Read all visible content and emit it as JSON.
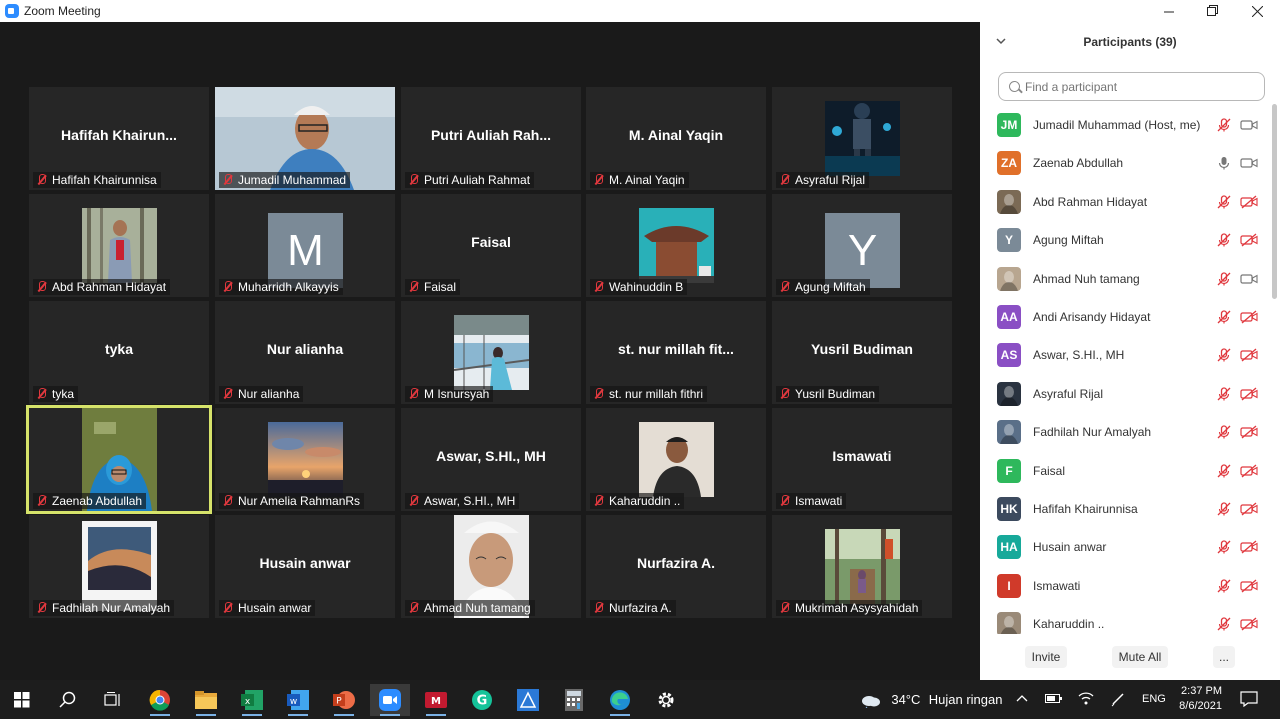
{
  "window": {
    "title": "Zoom Meeting"
  },
  "tiles": [
    {
      "label": "Hafifah Khairunnisa",
      "bigname": "Hafifah  Khairun...",
      "kind": "name"
    },
    {
      "label": "Jumadil Muhammad",
      "kind": "video-jumadil"
    },
    {
      "label": "Putri Auliah Rahmat",
      "bigname": "Putri  Auliah  Rah...",
      "kind": "name"
    },
    {
      "label": "M. Ainal Yaqin",
      "bigname": "M. Ainal Yaqin",
      "kind": "name"
    },
    {
      "label": "Asyraful Rijal",
      "kind": "photo-game"
    },
    {
      "label": "Abd Rahman Hidayat",
      "kind": "photo-park"
    },
    {
      "label": "Muharridh Alkayyis",
      "letter": "M",
      "kind": "letter"
    },
    {
      "label": "Faisal",
      "bigname": "Faisal",
      "kind": "name"
    },
    {
      "label": "Wahinuddin B",
      "kind": "photo-house"
    },
    {
      "label": "Agung Miftah",
      "letter": "Y",
      "kind": "letter"
    },
    {
      "label": "tyka",
      "bigname": "tyka",
      "kind": "name"
    },
    {
      "label": "Nur alianha",
      "bigname": "Nur alianha",
      "kind": "name"
    },
    {
      "label": "M Isnursyah",
      "kind": "photo-lake"
    },
    {
      "label": "st. nur millah fithri",
      "bigname": "st. nur millah fit...",
      "kind": "name"
    },
    {
      "label": "Yusril Budiman",
      "bigname": "Yusril Budiman",
      "kind": "name"
    },
    {
      "label": "Zaenab Abdullah",
      "kind": "video-zaenab",
      "active": true
    },
    {
      "label": "Nur Amelia RahmanRs",
      "kind": "photo-sunset"
    },
    {
      "label": "Aswar, S.HI., MH",
      "bigname": "Aswar, S.HI., MH",
      "kind": "name"
    },
    {
      "label": "Kaharuddin ..",
      "kind": "photo-man"
    },
    {
      "label": "Ismawati",
      "bigname": "Ismawati",
      "kind": "name"
    },
    {
      "label": "Fadhilah Nur Amalyah",
      "kind": "photo-sky"
    },
    {
      "label": "Husain anwar",
      "bigname": "Husain anwar",
      "kind": "name"
    },
    {
      "label": "Ahmad Nuh tamang",
      "kind": "photo-face"
    },
    {
      "label": "Nurfazira A.",
      "bigname": "Nurfazira A.",
      "kind": "name"
    },
    {
      "label": "Mukrimah Asysyahidah",
      "kind": "photo-forest"
    }
  ],
  "panel": {
    "title": "Participants (39)",
    "search_placeholder": "Find a participant",
    "participants": [
      {
        "name": "Jumadil Muhammad (Host, me)",
        "initials": "JM",
        "color": "#2eb85c",
        "mic": "off",
        "cam": "on"
      },
      {
        "name": "Zaenab Abdullah",
        "initials": "ZA",
        "color": "#e0702a",
        "mic": "on",
        "cam": "on"
      },
      {
        "name": "Abd Rahman Hidayat",
        "initials": "",
        "color": "#7b6a55",
        "mic": "off",
        "cam": "off"
      },
      {
        "name": "Agung Miftah",
        "initials": "Y",
        "color": "#7b8a97",
        "mic": "off",
        "cam": "off"
      },
      {
        "name": "Ahmad Nuh tamang",
        "initials": "",
        "color": "#b8a690",
        "mic": "off",
        "cam": "on"
      },
      {
        "name": "Andi Arisandy Hidayat",
        "initials": "AA",
        "color": "#8a4fc4",
        "mic": "off",
        "cam": "off"
      },
      {
        "name": "Aswar, S.HI., MH",
        "initials": "AS",
        "color": "#8a4fc4",
        "mic": "off",
        "cam": "off"
      },
      {
        "name": "Asyraful Rijal",
        "initials": "",
        "color": "#2a3340",
        "mic": "off",
        "cam": "off"
      },
      {
        "name": "Fadhilah Nur Amalyah",
        "initials": "",
        "color": "#5a6f88",
        "mic": "off",
        "cam": "off"
      },
      {
        "name": "Faisal",
        "initials": "F",
        "color": "#2eb85c",
        "mic": "off",
        "cam": "off"
      },
      {
        "name": "Hafifah Khairunnisa",
        "initials": "HK",
        "color": "#3c4a5e",
        "mic": "off",
        "cam": "off"
      },
      {
        "name": "Husain anwar",
        "initials": "HA",
        "color": "#17a99a",
        "mic": "off",
        "cam": "off"
      },
      {
        "name": "Ismawati",
        "initials": "I",
        "color": "#d03a2a",
        "mic": "off",
        "cam": "off"
      },
      {
        "name": "Kaharuddin ..",
        "initials": "",
        "color": "#9a8a78",
        "mic": "off",
        "cam": "off"
      }
    ],
    "invite_label": "Invite",
    "mute_all_label": "Mute All",
    "more_label": "..."
  },
  "taskbar": {
    "weather_temp": "34°C",
    "weather_text": "Hujan ringan",
    "language": "ENG",
    "time": "2:37 PM",
    "date": "8/6/2021"
  }
}
